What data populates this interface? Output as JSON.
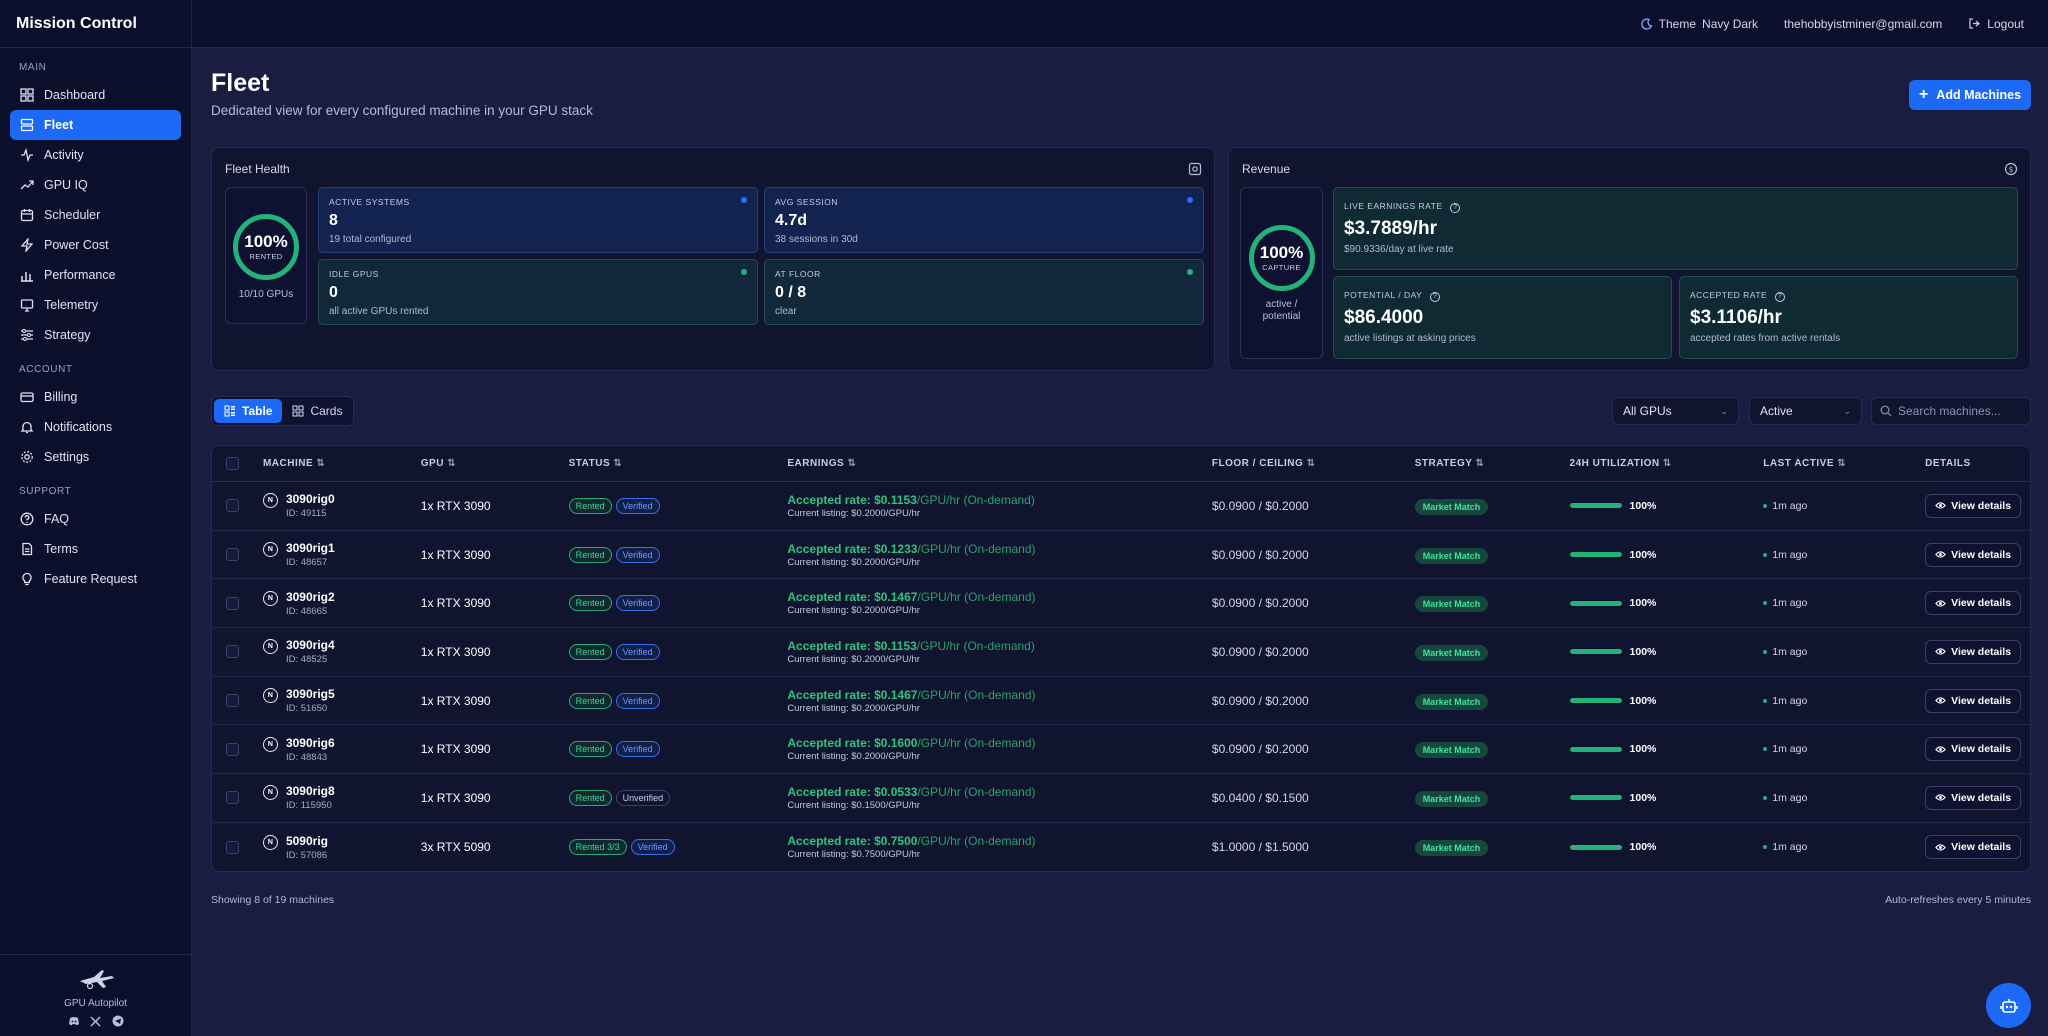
{
  "app": {
    "title": "Mission Control"
  },
  "nav": {
    "sections": [
      {
        "label": "MAIN",
        "items": [
          {
            "label": "Dashboard",
            "icon": "dashboard-icon"
          },
          {
            "label": "Fleet",
            "icon": "fleet-icon",
            "active": true
          },
          {
            "label": "Activity",
            "icon": "activity-icon"
          },
          {
            "label": "GPU IQ",
            "icon": "trend-icon"
          },
          {
            "label": "Scheduler",
            "icon": "calendar-icon"
          },
          {
            "label": "Power Cost",
            "icon": "bolt-icon"
          },
          {
            "label": "Performance",
            "icon": "bar-chart-icon"
          },
          {
            "label": "Telemetry",
            "icon": "monitor-icon"
          },
          {
            "label": "Strategy",
            "icon": "sliders-icon"
          }
        ]
      },
      {
        "label": "ACCOUNT",
        "items": [
          {
            "label": "Billing",
            "icon": "card-icon"
          },
          {
            "label": "Notifications",
            "icon": "bell-icon"
          },
          {
            "label": "Settings",
            "icon": "gear-icon"
          }
        ]
      },
      {
        "label": "SUPPORT",
        "items": [
          {
            "label": "FAQ",
            "icon": "help-icon"
          },
          {
            "label": "Terms",
            "icon": "document-icon"
          },
          {
            "label": "Feature Request",
            "icon": "lightbulb-icon"
          }
        ]
      }
    ],
    "footer": {
      "name": "GPU Autopilot"
    }
  },
  "topbar": {
    "theme_label": "Theme",
    "theme_value": "Navy Dark",
    "email": "thehobbyistminer@gmail.com",
    "logout": "Logout"
  },
  "page": {
    "title": "Fleet",
    "subtitle": "Dedicated view for every configured machine in your GPU stack",
    "add_button": "Add Machines"
  },
  "fleet_health": {
    "title": "Fleet Health",
    "ring": {
      "pct": "100%",
      "label": "RENTED",
      "caption": "10/10 GPUs"
    },
    "stats": [
      {
        "key": "ACTIVE SYSTEMS",
        "value": "8",
        "sub": "19 total configured"
      },
      {
        "key": "AVG SESSION",
        "value": "4.7d",
        "sub": "38 sessions in 30d"
      },
      {
        "key": "IDLE GPUS",
        "value": "0",
        "sub": "all active GPUs rented"
      },
      {
        "key": "AT FLOOR",
        "value": "0 / 8",
        "sub": "clear"
      }
    ]
  },
  "revenue": {
    "title": "Revenue",
    "ring": {
      "pct": "100%",
      "label": "CAPTURE",
      "caption1": "active /",
      "caption2": "potential"
    },
    "live": {
      "key": "LIVE EARNINGS RATE",
      "value": "$3.7889/hr",
      "sub": "$90.9336/day at live rate"
    },
    "potential": {
      "key": "POTENTIAL / DAY",
      "value": "$86.4000",
      "sub": "active listings at asking prices"
    },
    "accepted": {
      "key": "ACCEPTED RATE",
      "value": "$3.1106/hr",
      "sub": "accepted rates from active rentals"
    }
  },
  "view_toggle": {
    "table": "Table",
    "cards": "Cards"
  },
  "filters": {
    "gpu": "All GPUs",
    "status": "Active",
    "search_placeholder": "Search machines..."
  },
  "table": {
    "columns": [
      "MACHINE",
      "GPU",
      "STATUS",
      "EARNINGS",
      "FLOOR / CEILING",
      "STRATEGY",
      "24H UTILIZATION",
      "LAST ACTIVE",
      "DETAILS"
    ],
    "rows": [
      {
        "name": "3090rig0",
        "id": "ID: 49115",
        "gpu": "1x RTX 3090",
        "status": "Rented",
        "verified": "Verified",
        "rate": "Accepted rate: $0.1153",
        "unit": "/GPU/hr (On-demand)",
        "listing": "Current listing: $0.2000/GPU/hr",
        "floor": "$0.0900 / $0.2000",
        "strategy": "Market Match",
        "util": "100%",
        "util_frac": 1.0,
        "last": "1m ago",
        "details": "View details"
      },
      {
        "name": "3090rig1",
        "id": "ID: 48657",
        "gpu": "1x RTX 3090",
        "status": "Rented",
        "verified": "Verified",
        "rate": "Accepted rate: $0.1233",
        "unit": "/GPU/hr (On-demand)",
        "listing": "Current listing: $0.2000/GPU/hr",
        "floor": "$0.0900 / $0.2000",
        "strategy": "Market Match",
        "util": "100%",
        "util_frac": 1.0,
        "last": "1m ago",
        "details": "View details"
      },
      {
        "name": "3090rig2",
        "id": "ID: 48665",
        "gpu": "1x RTX 3090",
        "status": "Rented",
        "verified": "Verified",
        "rate": "Accepted rate: $0.1467",
        "unit": "/GPU/hr (On-demand)",
        "listing": "Current listing: $0.2000/GPU/hr",
        "floor": "$0.0900 / $0.2000",
        "strategy": "Market Match",
        "util": "100%",
        "util_frac": 1.0,
        "last": "1m ago",
        "details": "View details"
      },
      {
        "name": "3090rig4",
        "id": "ID: 48525",
        "gpu": "1x RTX 3090",
        "status": "Rented",
        "verified": "Verified",
        "rate": "Accepted rate: $0.1153",
        "unit": "/GPU/hr (On-demand)",
        "listing": "Current listing: $0.2000/GPU/hr",
        "floor": "$0.0900 / $0.2000",
        "strategy": "Market Match",
        "util": "100%",
        "util_frac": 1.0,
        "last": "1m ago",
        "details": "View details"
      },
      {
        "name": "3090rig5",
        "id": "ID: 51650",
        "gpu": "1x RTX 3090",
        "status": "Rented",
        "verified": "Verified",
        "rate": "Accepted rate: $0.1467",
        "unit": "/GPU/hr (On-demand)",
        "listing": "Current listing: $0.2000/GPU/hr",
        "floor": "$0.0900 / $0.2000",
        "strategy": "Market Match",
        "util": "100%",
        "util_frac": 1.0,
        "last": "1m ago",
        "details": "View details"
      },
      {
        "name": "3090rig6",
        "id": "ID: 48843",
        "gpu": "1x RTX 3090",
        "status": "Rented",
        "verified": "Verified",
        "rate": "Accepted rate: $0.1600",
        "unit": "/GPU/hr (On-demand)",
        "listing": "Current listing: $0.2000/GPU/hr",
        "floor": "$0.0900 / $0.2000",
        "strategy": "Market Match",
        "util": "100%",
        "util_frac": 1.0,
        "last": "1m ago",
        "details": "View details"
      },
      {
        "name": "3090rig8",
        "id": "ID: 115950",
        "gpu": "1x RTX 3090",
        "status": "Rented",
        "verified": "Unverified",
        "rate": "Accepted rate: $0.0533",
        "unit": "/GPU/hr (On-demand)",
        "listing": "Current listing: $0.1500/GPU/hr",
        "floor": "$0.0400 / $0.1500",
        "strategy": "Market Match",
        "util": "100%",
        "util_frac": 1.0,
        "last": "1m ago",
        "details": "View details"
      },
      {
        "name": "5090rig",
        "id": "ID: 57086",
        "gpu": "3x RTX 5090",
        "status": "Rented 3/3",
        "verified": "Verified",
        "rate": "Accepted rate: $0.7500",
        "unit": "/GPU/hr (On-demand)",
        "listing": "Current listing: $0.7500/GPU/hr",
        "floor": "$1.0000 / $1.5000",
        "strategy": "Market Match",
        "util": "100%",
        "util_frac": 1.0,
        "last": "1m ago",
        "details": "View details"
      }
    ],
    "footer_left": "Showing 8 of 19 machines",
    "footer_right": "Auto-refreshes every 5 minutes"
  },
  "colors": {
    "accent": "#1c69f5",
    "success": "#22b27a",
    "background": "#1a1c42",
    "sidebar": "#0c0f2b"
  }
}
